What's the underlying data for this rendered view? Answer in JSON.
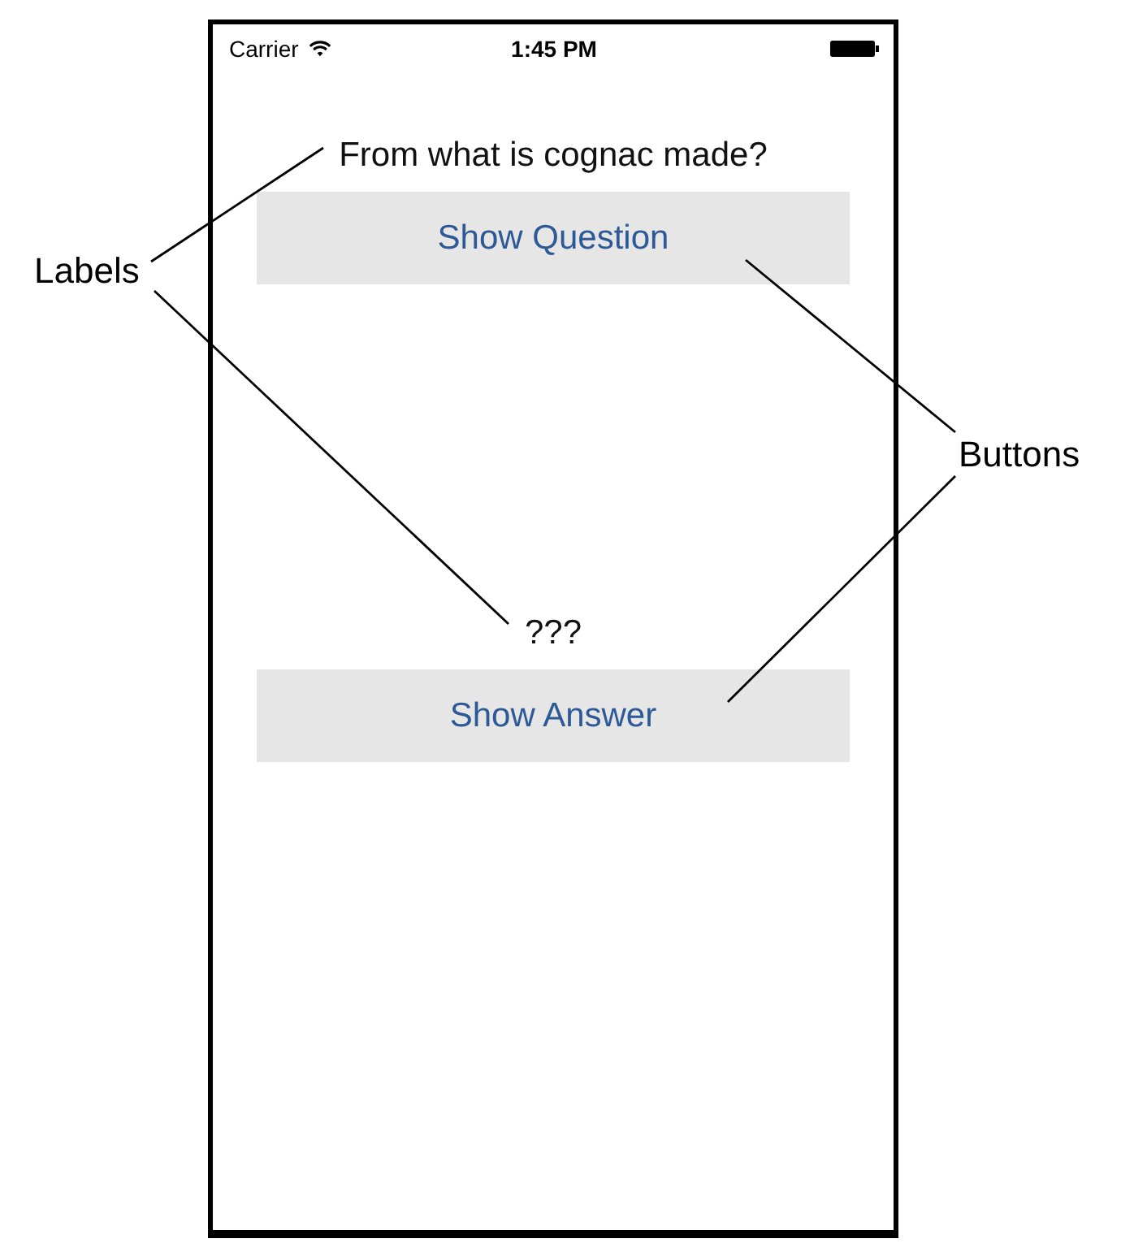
{
  "status_bar": {
    "carrier": "Carrier",
    "time": "1:45 PM"
  },
  "sections": [
    {
      "label": "From what is cognac made?",
      "button": "Show Question"
    },
    {
      "label": "???",
      "button": "Show Answer"
    }
  ],
  "callouts": [
    {
      "text": "Labels"
    },
    {
      "text": "Buttons"
    }
  ]
}
